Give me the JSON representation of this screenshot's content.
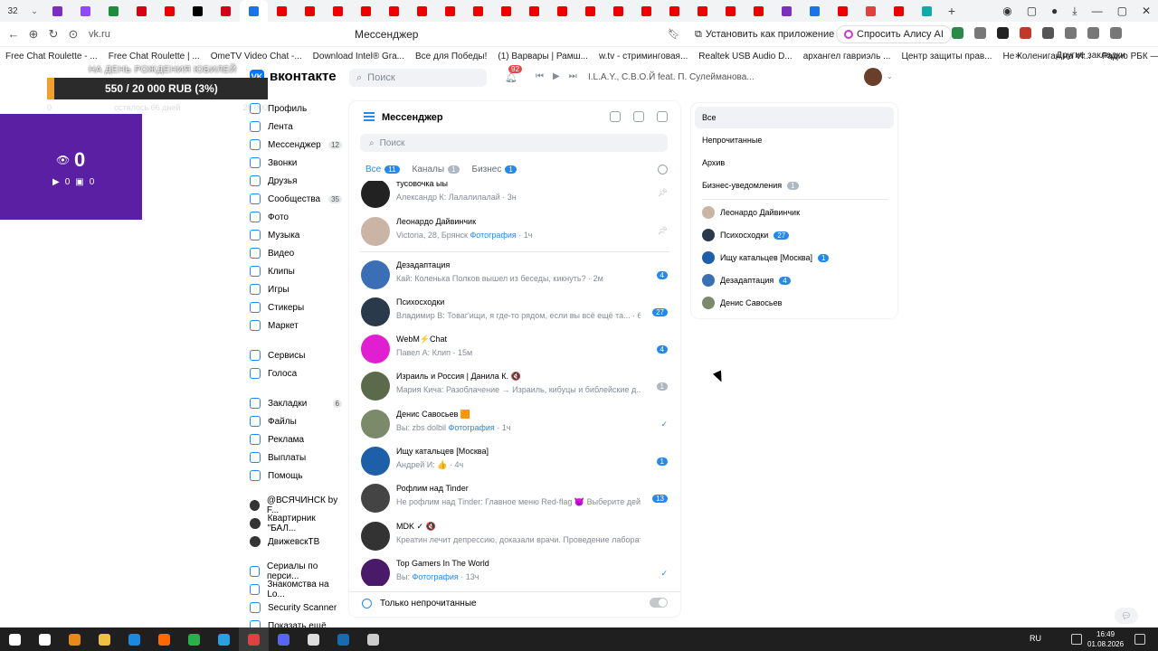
{
  "browser": {
    "tab_count": "32",
    "tab_icons": [
      "#7b2fbe",
      "#9146ff",
      "#1e8c3a",
      "#d60017",
      "#e00",
      "#000",
      "#d60017",
      "#1a73e8",
      "#e00",
      "#e00",
      "#e00",
      "#e00",
      "#e00",
      "#e00",
      "#e00",
      "#e00",
      "#e00",
      "#e00",
      "#e00",
      "#e00",
      "#e00",
      "#e00",
      "#e00",
      "#e00",
      "#e00",
      "#e00",
      "#7b2fbe",
      "#1a73e8",
      "#e00",
      "#e04040",
      "#e00",
      "#1aa"
    ],
    "active_tab_index": 7,
    "url": "vk.ru",
    "page_title": "Мессенджер",
    "install_label": "Установить как приложение",
    "alice_label": "Спросить Алису AI",
    "bookmarks": [
      "Free Chat Roulette - ...",
      "Free Chat Roulette | ...",
      "OmeTV Video Chat -...",
      "Download Intel® Gra...",
      "Все для Победы!",
      "(1) Варвары | Рамш...",
      "w.tv - стриминговая...",
      "Realtek USB Audio D...",
      "архангел гавриэль ...",
      "Центр защиты прав...",
      "Не Колениган на Vi...",
      "Радио РБК — после..."
    ],
    "other_bookmarks": "Другие закладки"
  },
  "vk": {
    "logo_text": "вконтакте",
    "search_placeholder": "Поиск",
    "notif_count": "92",
    "track": "I.L.A.Y., С.В.О.Й feat. П. Сулейманова..."
  },
  "overlay": {
    "caption": "НА ДЕНЬ РОЖДЕНИЯ ЮБИЛЕЙ",
    "progress_text": "550 / 20 000 RUB (3%)",
    "progress_fraction": 0.03,
    "sub_left": "0",
    "sub_mid": "осталось 66 дней",
    "sub_right": "20 000",
    "viewers": "0",
    "yt_count": "0",
    "twitch_count": "0"
  },
  "left_menu": [
    {
      "label": "Профиль",
      "count": ""
    },
    {
      "label": "Лента",
      "count": ""
    },
    {
      "label": "Мессенджер",
      "count": "12"
    },
    {
      "label": "Звонки",
      "count": ""
    },
    {
      "label": "Друзья",
      "count": ""
    },
    {
      "label": "Сообщества",
      "count": "35"
    },
    {
      "label": "Фото",
      "count": ""
    },
    {
      "label": "Музыка",
      "count": ""
    },
    {
      "label": "Видео",
      "count": ""
    },
    {
      "label": "Клипы",
      "count": ""
    },
    {
      "label": "Игры",
      "count": ""
    },
    {
      "label": "Стикеры",
      "count": ""
    },
    {
      "label": "Маркет",
      "count": ""
    },
    {
      "label": "Сервисы",
      "count": ""
    },
    {
      "label": "Голоса",
      "count": ""
    },
    {
      "label": "Закладки",
      "count": "6"
    },
    {
      "label": "Файлы",
      "count": ""
    },
    {
      "label": "Реклама",
      "count": ""
    },
    {
      "label": "Выплаты",
      "count": ""
    },
    {
      "label": "Помощь",
      "count": ""
    },
    {
      "label": "@ВСЯЧИНСК by F...",
      "count": ""
    },
    {
      "label": "Квартирник \"БАЛ...",
      "count": ""
    },
    {
      "label": "ДвижевскТВ",
      "count": ""
    },
    {
      "label": "Сериалы по перси...",
      "count": ""
    },
    {
      "label": "Знакомства на Lo...",
      "count": ""
    },
    {
      "label": "Security Scanner",
      "count": ""
    },
    {
      "label": "Показать ещё",
      "count": ""
    }
  ],
  "messenger": {
    "title": "Мессенджер",
    "search_placeholder": "Поиск",
    "tabs": [
      {
        "label": "Все",
        "count": "11"
      },
      {
        "label": "Каналы",
        "count": "1"
      },
      {
        "label": "Бизнес",
        "count": "1"
      }
    ],
    "conversations": [
      {
        "name": "тусовочка ыы",
        "preview": "Александр К: Лалалилалай",
        "time": "3н",
        "badge": "",
        "pin": true,
        "check": false,
        "color": "#222"
      },
      {
        "name": "Леонардо Дайвинчик",
        "preview": "Victoria, 28, Брянск",
        "preview_link": "Фотография",
        "time": "1ч",
        "badge": "",
        "pin": true,
        "check": false,
        "color": "#c9b4a5"
      },
      {
        "name": "Дезадаптация",
        "preview": "Кай: Коленька Полков вышел из беседы, кикнуть?",
        "time": "2м",
        "badge": "4",
        "pin": false,
        "check": false,
        "color": "#3a6fb5"
      },
      {
        "name": "Психосходки",
        "preview": "Владимир В: Товаг'ищи, я где-то рядом, если вы всё ещё та...",
        "time": "6м",
        "badge": "27",
        "pin": false,
        "check": false,
        "color": "#2a3a4a"
      },
      {
        "name": "WebM⚡Chat",
        "preview": "Павел А: Клип",
        "time": "15м",
        "badge": "4",
        "pin": false,
        "check": false,
        "color": "#e020d0"
      },
      {
        "name": "Израиль и Россия | Данила К. 🔇",
        "preview": "Мария Кича: Разоблачение → Израиль, кибуцы и библейские д...",
        "time": "55м",
        "badge": "1",
        "badge_gray": true,
        "pin": false,
        "check": false,
        "color": "#5a6a4a"
      },
      {
        "name": "Денис Савосьев 🟧",
        "preview": "Вы: zbs dolbil",
        "preview_link": "Фотография",
        "time": "1ч",
        "badge": "",
        "pin": false,
        "check": true,
        "color": "#7a8a6a"
      },
      {
        "name": "Ищу катальцев [Москва]",
        "preview": "Андрей И: 👍",
        "time": "4ч",
        "badge": "1",
        "pin": false,
        "check": false,
        "color": "#1d5fa8"
      },
      {
        "name": "Рофлим над Tinder",
        "preview": "Не рофлим над Tinder: Главное меню Red-flag 😈 Выберите дей...",
        "time": "7ч",
        "badge": "13",
        "pin": false,
        "check": false,
        "color": "#444"
      },
      {
        "name": "MDK ✓ 🔇",
        "preview": "Креатин лечит депрессию, доказали врачи. Проведение лаборатор...",
        "time": "7ч",
        "badge": "",
        "pin": false,
        "check": false,
        "color": "#333"
      },
      {
        "name": "Top Gamers In The World",
        "preview": "Вы:",
        "preview_link": "Фотография",
        "time": "13ч",
        "badge": "",
        "pin": false,
        "check": true,
        "color": "#4a1a6a"
      }
    ],
    "footer_label": "Только непрочитанные"
  },
  "filters": {
    "items": [
      {
        "label": "Все",
        "count": ""
      },
      {
        "label": "Непрочитанные",
        "count": ""
      },
      {
        "label": "Архив",
        "count": ""
      },
      {
        "label": "Бизнес-уведомления",
        "count": "1"
      }
    ],
    "folders": [
      {
        "label": "Леонардо Дайвинчик",
        "count": "",
        "color": "#c9b4a5"
      },
      {
        "label": "Психосходки",
        "count": "27",
        "color": "#2a3a4a"
      },
      {
        "label": "Ищу катальцев [Москва]",
        "count": "1",
        "color": "#1d5fa8"
      },
      {
        "label": "Дезадаптация",
        "count": "4",
        "color": "#3a6fb5"
      },
      {
        "label": "Денис Савосьев",
        "count": "",
        "color": "#7a8a6a"
      }
    ]
  },
  "taskbar": {
    "icons": [
      "#fff",
      "#fff",
      "#e88a1a",
      "#f0c040",
      "#1a8ae0",
      "#ff6a00",
      "#2ab04a",
      "#2aa0e0",
      "#e04040",
      "#5865f2",
      "#ddd",
      "#1a6ab0",
      "#ccc"
    ],
    "lang": "RU",
    "time": "16:49",
    "date": "01.08.2026"
  }
}
